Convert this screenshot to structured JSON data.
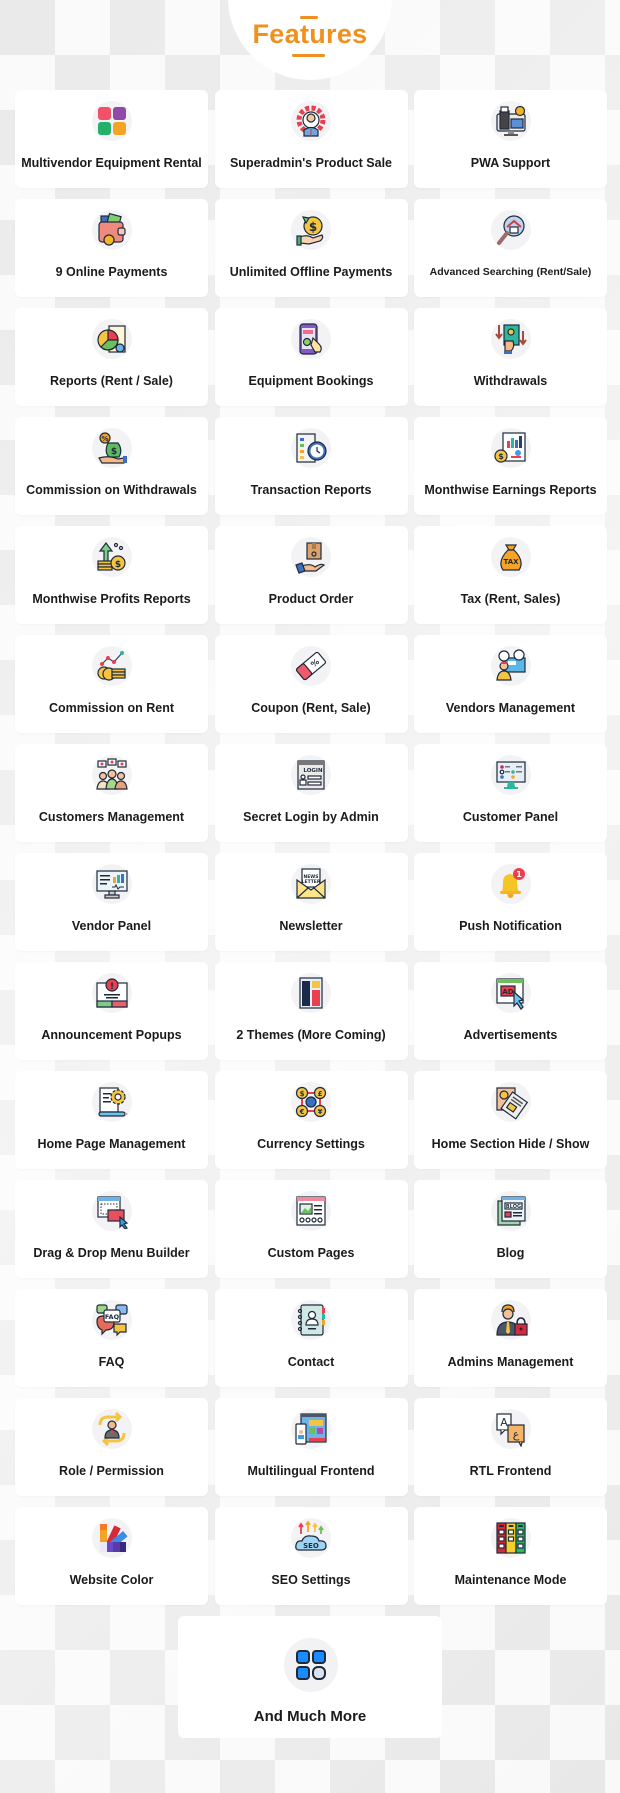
{
  "header": {
    "title": "Features",
    "accent_color": "#F0901E"
  },
  "features": [
    {
      "label": "Multivendor Equipment Rental",
      "icon": "app-grid-icon"
    },
    {
      "label": "Superadmin's Product Sale",
      "icon": "admin-gear-icon"
    },
    {
      "label": "PWA Support",
      "icon": "pos-monitor-icon"
    },
    {
      "label": "9 Online Payments",
      "icon": "wallet-icon"
    },
    {
      "label": "Unlimited Offline Payments",
      "icon": "hand-coin-icon"
    },
    {
      "label": "Advanced Searching (Rent/Sale)",
      "icon": "search-house-icon"
    },
    {
      "label": "Reports (Rent / Sale)",
      "icon": "pie-report-icon"
    },
    {
      "label": "Equipment Bookings",
      "icon": "phone-booking-icon"
    },
    {
      "label": "Withdrawals",
      "icon": "cash-withdraw-icon"
    },
    {
      "label": "Commission on Withdrawals",
      "icon": "commission-bag-icon"
    },
    {
      "label": "Transaction Reports",
      "icon": "checklist-clock-icon"
    },
    {
      "label": "Monthwise Earnings Reports",
      "icon": "earnings-chart-icon"
    },
    {
      "label": "Monthwise Profits Reports",
      "icon": "profit-coins-icon"
    },
    {
      "label": "Product Order",
      "icon": "box-hand-icon"
    },
    {
      "label": "Tax (Rent, Sales)",
      "icon": "tax-bag-icon"
    },
    {
      "label": "Commission on Rent",
      "icon": "coins-graph-icon"
    },
    {
      "label": "Coupon (Rent, Sale)",
      "icon": "coupon-icon"
    },
    {
      "label": "Vendors Management",
      "icon": "vendor-desk-icon"
    },
    {
      "label": "Customers Management",
      "icon": "customers-group-icon"
    },
    {
      "label": "Secret Login by Admin",
      "icon": "login-window-icon"
    },
    {
      "label": "Customer Panel",
      "icon": "panel-monitor-icon"
    },
    {
      "label": "Vendor Panel",
      "icon": "dashboard-monitor-icon"
    },
    {
      "label": "Newsletter",
      "icon": "newsletter-envelope-icon"
    },
    {
      "label": "Push Notification",
      "icon": "bell-notification-icon",
      "badge": "1"
    },
    {
      "label": "Announcement Popups",
      "icon": "alert-popup-icon"
    },
    {
      "label": "2 Themes (More Coming)",
      "icon": "theme-layout-icon"
    },
    {
      "label": "Advertisements",
      "icon": "ad-click-icon"
    },
    {
      "label": "Home Page Management",
      "icon": "page-gear-icon"
    },
    {
      "label": "Currency Settings",
      "icon": "currency-globe-icon"
    },
    {
      "label": "Home Section Hide / Show",
      "icon": "newspaper-icon"
    },
    {
      "label": "Drag & Drop Menu Builder",
      "icon": "drag-drop-icon"
    },
    {
      "label": "Custom Pages",
      "icon": "custom-page-icon"
    },
    {
      "label": "Blog",
      "icon": "blog-icon"
    },
    {
      "label": "FAQ",
      "icon": "faq-bubbles-icon"
    },
    {
      "label": "Contact",
      "icon": "contact-book-icon"
    },
    {
      "label": "Admins Management",
      "icon": "admin-lock-icon"
    },
    {
      "label": "Role / Permission",
      "icon": "role-switch-icon"
    },
    {
      "label": "Multilingual Frontend",
      "icon": "multilingual-screen-icon"
    },
    {
      "label": "RTL Frontend",
      "icon": "rtl-language-icon"
    },
    {
      "label": "Website Color",
      "icon": "color-palette-icon"
    },
    {
      "label": "SEO Settings",
      "icon": "seo-cloud-icon"
    },
    {
      "label": "Maintenance Mode",
      "icon": "maintenance-board-icon"
    }
  ],
  "more": {
    "label": "And Much More",
    "icon": "more-apps-icon"
  }
}
